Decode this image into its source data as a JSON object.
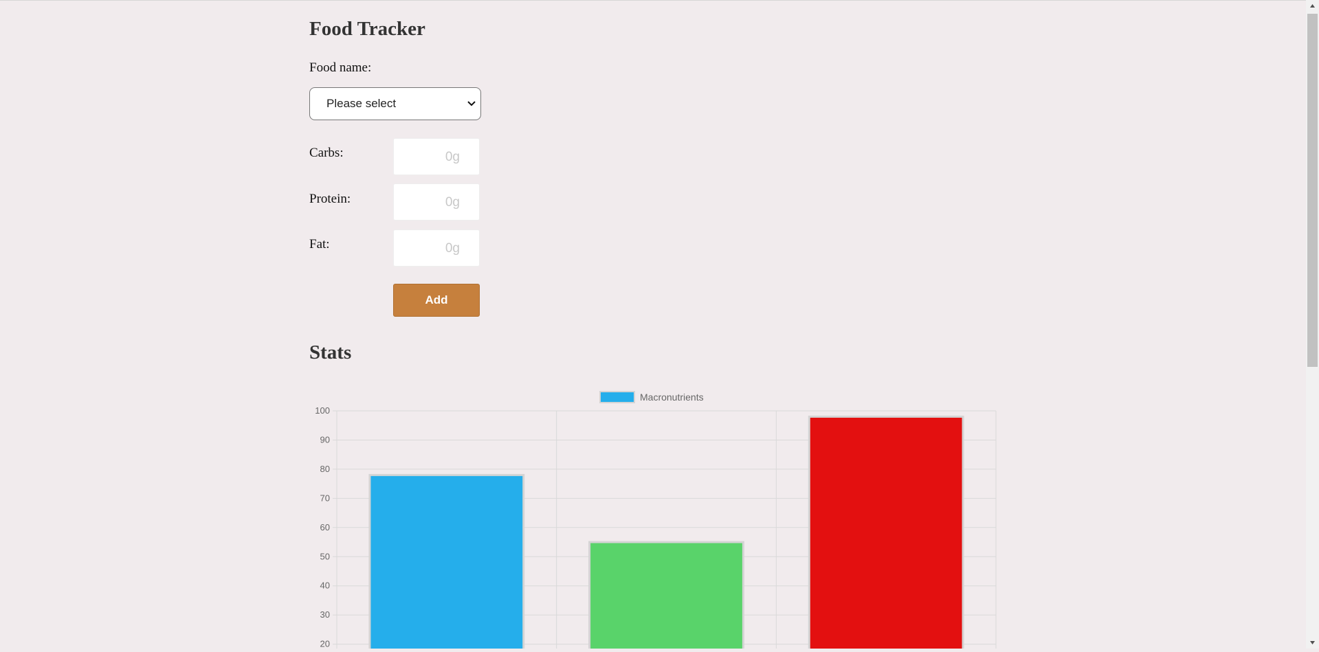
{
  "header": {
    "title": "Food Tracker"
  },
  "form": {
    "food_label": "Food name:",
    "food_select_value": "Please select",
    "carbs_label": "Carbs:",
    "carbs_placeholder": "0g",
    "protein_label": "Protein:",
    "protein_placeholder": "0g",
    "fat_label": "Fat:",
    "fat_placeholder": "0g",
    "add_label": "Add"
  },
  "stats": {
    "title": "Stats"
  },
  "colors": {
    "background": "#f1ebed",
    "add_button": "#c6803d",
    "bar_colors": [
      "#25aeeb",
      "#59d36a",
      "#e31010"
    ]
  },
  "icons": {
    "select_caret": "chevron-down-icon",
    "scroll_up": "arrow-up-icon",
    "scroll_down": "arrow-down-icon"
  },
  "chart_data": {
    "type": "bar",
    "categories": [
      "",
      "",
      ""
    ],
    "series": [
      {
        "name": "Macronutrients",
        "values": [
          78,
          55,
          98
        ]
      }
    ],
    "ylim": [
      20,
      100
    ],
    "yticks": [
      "100",
      "90",
      "80",
      "70",
      "60",
      "50",
      "40",
      "30",
      "20"
    ],
    "grid": true,
    "legend": "top-center"
  }
}
